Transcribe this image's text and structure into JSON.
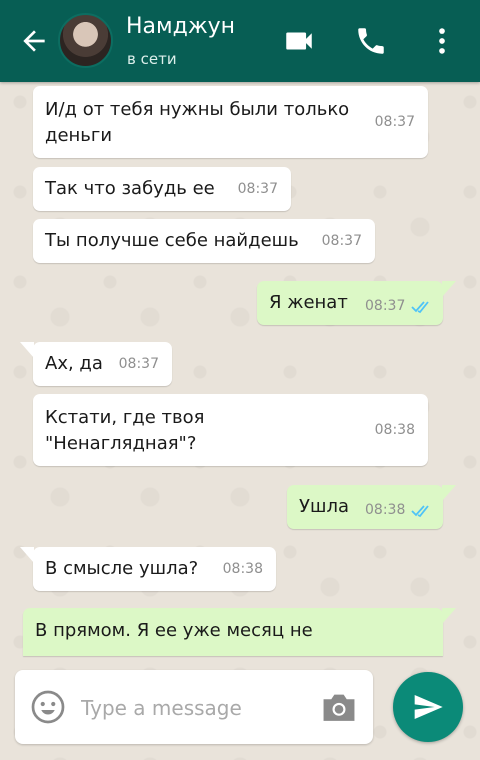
{
  "header": {
    "contact_name": "Намджун",
    "status": "в сети",
    "color": "#075e54"
  },
  "messages": [
    {
      "direction": "in",
      "text": "И/д от тебя нужны были только\nденьги",
      "time": "08:37"
    },
    {
      "direction": "in",
      "text": "Так что забудь ее",
      "time": "08:37"
    },
    {
      "direction": "in",
      "text": "Ты получше себе найдешь",
      "time": "08:37"
    },
    {
      "direction": "out",
      "text": "Я женат",
      "time": "08:37",
      "read": true
    },
    {
      "direction": "in",
      "text": "Ах, да",
      "time": "08:37"
    },
    {
      "direction": "in",
      "text": "Кстати, где твоя\n\"Ненаглядная\"?",
      "time": "08:38"
    },
    {
      "direction": "out",
      "text": "Ушла",
      "time": "08:38",
      "read": true
    },
    {
      "direction": "in",
      "text": "В смысле ушла?",
      "time": "08:38"
    },
    {
      "direction": "out",
      "text": "В прямом. Я ее уже месяц не",
      "time": ""
    }
  ],
  "composer": {
    "placeholder": "Type a message"
  },
  "icons": {
    "back": "arrow-back-icon",
    "video": "video-call-icon",
    "phone": "phone-icon",
    "menu": "more-vert-icon",
    "emoji": "emoji-icon",
    "camera": "camera-icon",
    "send": "send-icon",
    "ticks": "double-check-icon"
  },
  "colors": {
    "incoming_bubble": "#ffffff",
    "outgoing_bubble": "#dcf8c6",
    "read_ticks": "#4fc3f7",
    "send_button": "#0b8a78"
  }
}
